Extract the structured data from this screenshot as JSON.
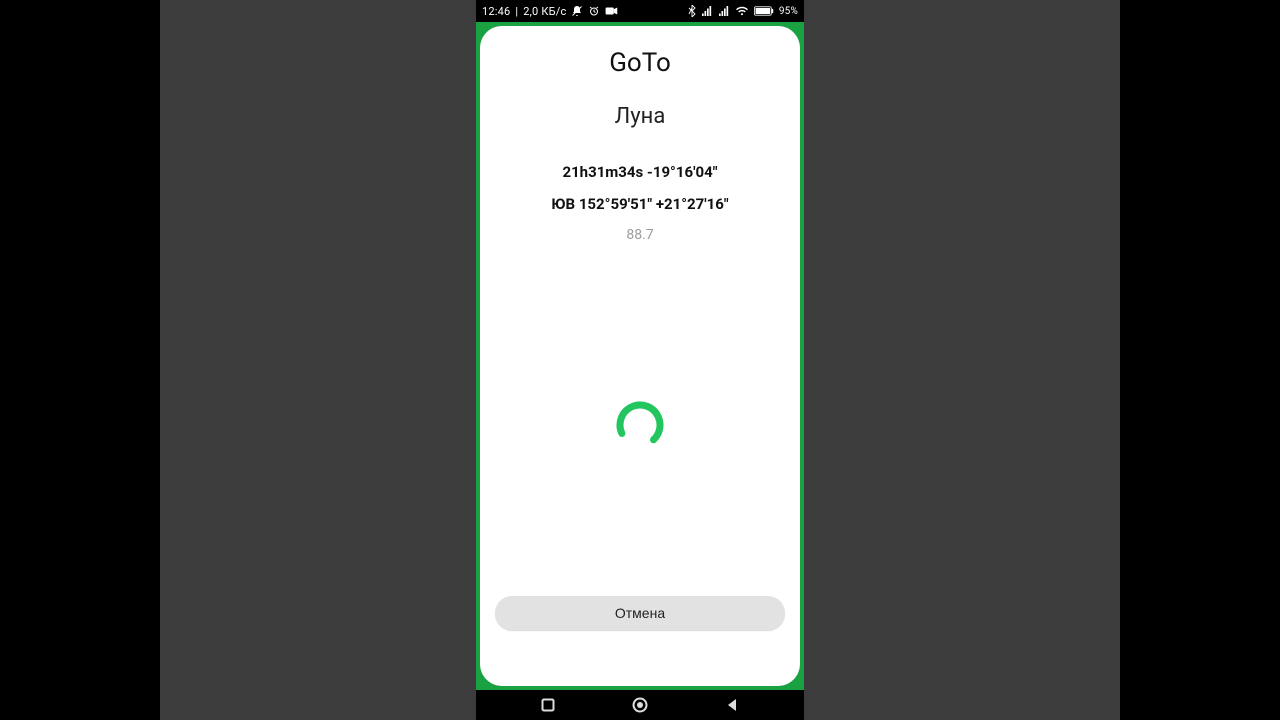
{
  "statusbar": {
    "time": "12:46",
    "separator": "|",
    "data_rate": "2,0 КБ/с",
    "battery_percent": "95%"
  },
  "dialog": {
    "title": "GoTo",
    "subtitle": "Луна",
    "coord1": "21h31m34s -19°16'04\"",
    "coord2": "ЮВ 152°59'51\" +21°27'16\"",
    "value": "88.7"
  },
  "buttons": {
    "cancel": "Отмена"
  },
  "colors": {
    "accent": "#23c55e"
  }
}
